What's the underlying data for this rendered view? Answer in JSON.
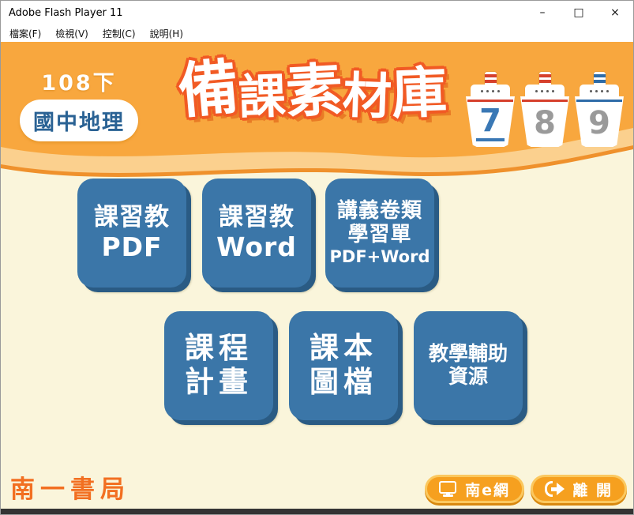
{
  "colors": {
    "header_orange": "#F8A73E",
    "wave_light": "#FBD08E",
    "wave_line": "#EF912C",
    "body_cream": "#FAF5DB",
    "button_blue": "#3B76A8",
    "button_blue_dark": "#2A5B84",
    "title_outline": "#F15A24",
    "badge_text_blue": "#2A6294",
    "boat_red": "#D6402C",
    "boat_blue": "#2E6CA8",
    "number_gray": "#9A9A9A",
    "active_number_blue": "#3A78B5",
    "footer_orange": "#F6A01F",
    "footer_orange_light": "#FBC85F",
    "footer_orange_dark": "#D8880F",
    "publisher_orange": "#F26F21",
    "bottom_bar": "#333333"
  },
  "window": {
    "title": "Adobe Flash Player 11",
    "minimize_glyph": "–",
    "maximize_glyph": "□",
    "close_glyph": "×"
  },
  "menu": {
    "items": [
      "檔案(F)",
      "檢視(V)",
      "控制(C)",
      "說明(H)"
    ]
  },
  "header": {
    "grade_label": "108下",
    "subject_label": "國中地理",
    "title": "備課素材庫",
    "title_chars": [
      "備",
      "課",
      "素",
      "材",
      "庫"
    ],
    "boats": [
      {
        "number": "7",
        "active": true,
        "accent": "red"
      },
      {
        "number": "8",
        "active": false,
        "accent": "red"
      },
      {
        "number": "9",
        "active": false,
        "accent": "blue"
      }
    ]
  },
  "main": {
    "buttons": [
      {
        "lines": [
          "課習教",
          "PDF"
        ]
      },
      {
        "lines": [
          "課習教",
          "Word"
        ]
      },
      {
        "lines": [
          "講義卷類",
          "學習單",
          "PDF+Word"
        ]
      },
      {
        "lines": [
          "課程",
          "計畫"
        ]
      },
      {
        "lines": [
          "課本",
          "圖檔"
        ]
      },
      {
        "lines": [
          "教學輔助",
          "資源"
        ]
      }
    ]
  },
  "footer": {
    "publisher": "南一書局",
    "nan_e_net_label": "南e網",
    "exit_label": "離 開"
  }
}
